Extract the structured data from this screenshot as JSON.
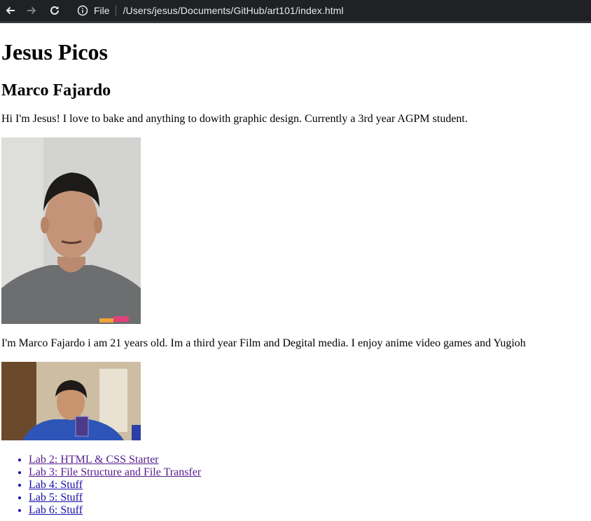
{
  "browser": {
    "scheme_label": "File",
    "url": "/Users/jesus/Documents/GitHub/art101/index.html"
  },
  "page": {
    "title": "Jesus Picos",
    "subtitle": "Marco Fajardo",
    "bio_jesus": "Hi I'm Jesus! I love to bake and anything to dowith graphic design. Currently a 3rd year AGPM student.",
    "bio_marco": "I'm Marco Fajardo i am 21 years old. Im a third year Film and Degital media. I enjoy anime video games and Yugioh",
    "labs": [
      {
        "label": "Lab 2: HTML & CSS Starter",
        "visited": true
      },
      {
        "label": "Lab 3: File Structure and File Transfer",
        "visited": true
      },
      {
        "label": "Lab 4: Stuff",
        "visited": false
      },
      {
        "label": "Lab 5: Stuff",
        "visited": false
      },
      {
        "label": "Lab 6: Stuff",
        "visited": false
      }
    ]
  }
}
